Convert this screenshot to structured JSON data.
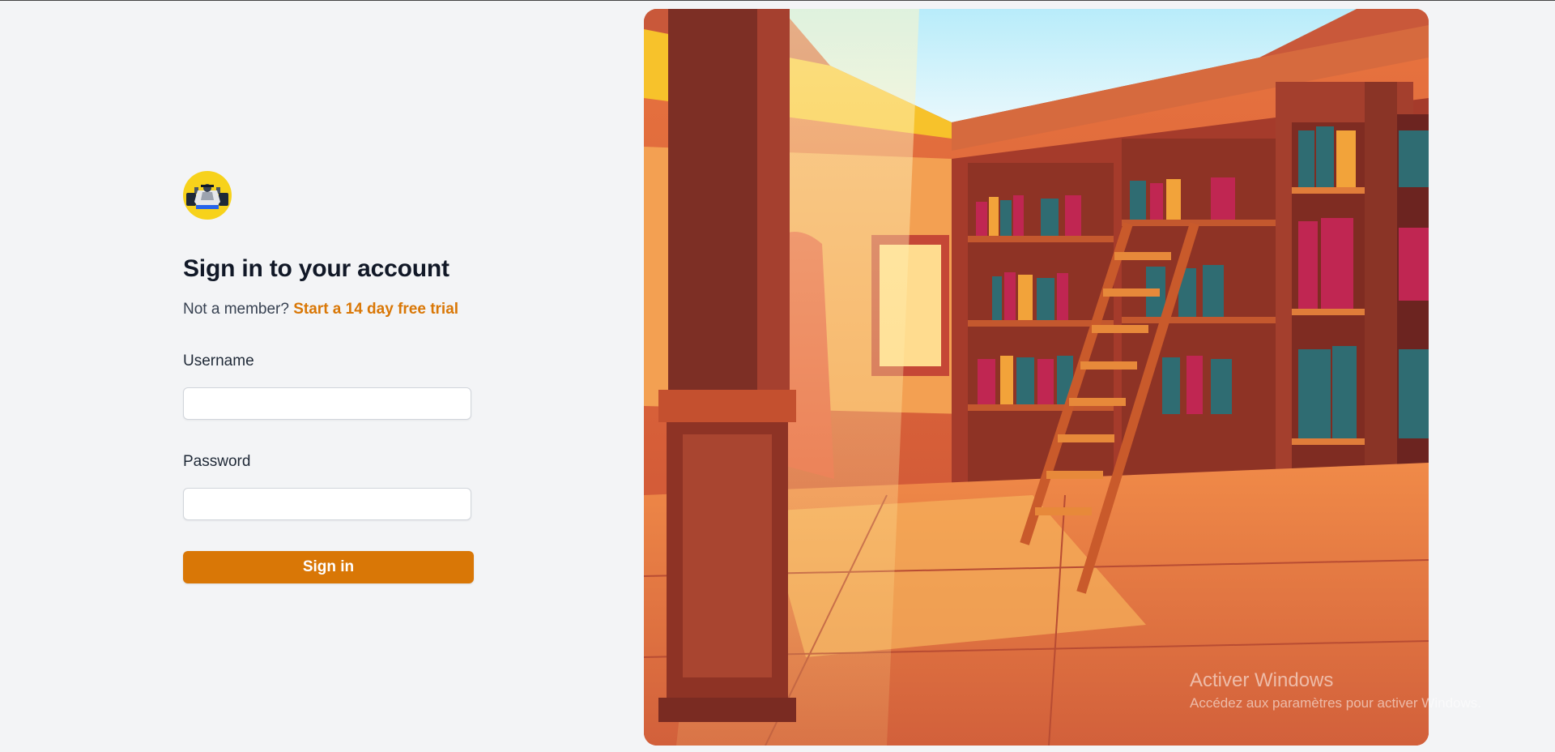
{
  "auth": {
    "heading": "Sign in to your account",
    "member_prompt": "Not a member?",
    "trial_link": "Start a 14 day free trial",
    "username_label": "Username",
    "username_value": "",
    "password_label": "Password",
    "password_value": "",
    "submit_label": "Sign in"
  },
  "icons": {
    "logo": "race-car-logo-icon"
  },
  "watermark": {
    "title": "Activer Windows",
    "subtitle": "Accédez aux paramètres pour activer Windows."
  },
  "colors": {
    "accent": "#d97706",
    "background": "#f3f4f6",
    "logo_background": "#f7d21b"
  }
}
